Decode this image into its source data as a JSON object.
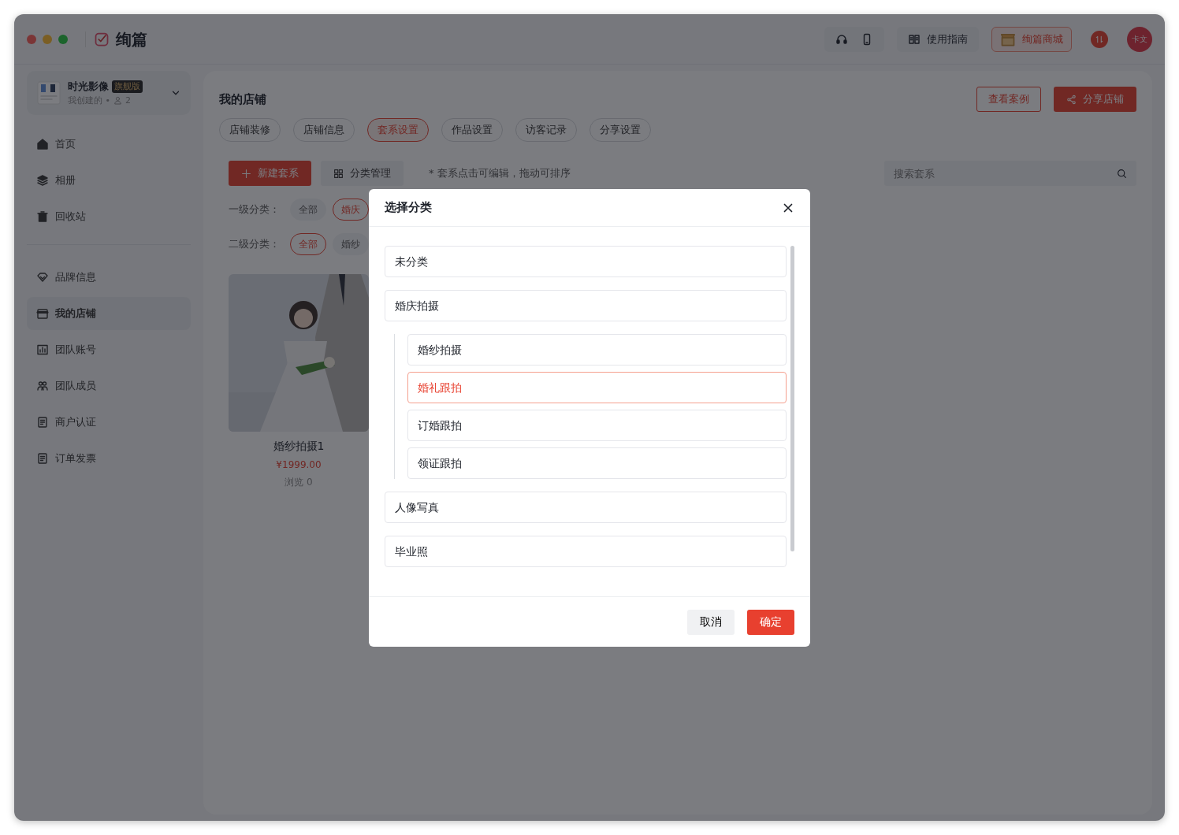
{
  "window": {
    "app_name": "绚篇"
  },
  "header": {
    "guide": "使用指南",
    "mall": "绚篇商城",
    "avatar": "卡文"
  },
  "account": {
    "name": "时光影像",
    "tier": "旗舰版",
    "meta": "我创建的 •",
    "members": "2"
  },
  "sidebar": {
    "groups": [
      [
        {
          "label": "首页",
          "selected": false
        },
        {
          "label": "相册",
          "selected": false
        },
        {
          "label": "回收站",
          "selected": false
        }
      ],
      [
        {
          "label": "品牌信息",
          "selected": false
        },
        {
          "label": "我的店铺",
          "selected": true
        },
        {
          "label": "团队账号",
          "selected": false
        },
        {
          "label": "团队成员",
          "selected": false
        },
        {
          "label": "商户认证",
          "selected": false
        },
        {
          "label": "订单发票",
          "selected": false
        }
      ]
    ]
  },
  "page": {
    "title": "我的店铺",
    "actions": [
      "查看案例",
      "分享店铺"
    ]
  },
  "tabs": [
    {
      "label": "店铺装修",
      "selected": false
    },
    {
      "label": "店铺信息",
      "selected": false
    },
    {
      "label": "套系设置",
      "selected": true
    },
    {
      "label": "作品设置",
      "selected": false
    },
    {
      "label": "访客记录",
      "selected": false
    },
    {
      "label": "分享设置",
      "selected": false
    }
  ],
  "toolbar": {
    "new": "新建套系",
    "manage": "分类管理",
    "hint": "* 套系点击可编辑，拖动可排序",
    "search_placeholder": "搜索套系"
  },
  "filters": [
    {
      "label": "一级分类：",
      "chips": [
        {
          "label": "全部",
          "selected": false
        },
        {
          "label": "婚庆",
          "selected": true
        }
      ]
    },
    {
      "label": "二级分类：",
      "chips": [
        {
          "label": "全部",
          "selected": true
        },
        {
          "label": "婚纱",
          "selected": false
        }
      ]
    }
  ],
  "products": [
    {
      "kind": "picture",
      "title": "婚纱拍摄1",
      "price": "¥1999.00",
      "views": "浏览 0"
    }
  ],
  "dialog": {
    "title": "选择分类",
    "categories": [
      {
        "label": "未分类",
        "selected": false
      },
      {
        "label": "婚庆拍摄",
        "selected": false,
        "children": [
          {
            "label": "婚纱拍摄",
            "selected": false
          },
          {
            "label": "婚礼跟拍",
            "selected": true
          },
          {
            "label": "订婚跟拍",
            "selected": false
          },
          {
            "label": "领证跟拍",
            "selected": false
          }
        ]
      },
      {
        "label": "人像写真",
        "selected": false
      },
      {
        "label": "毕业照",
        "selected": false
      }
    ],
    "buttons": [
      "取消",
      "确定"
    ]
  }
}
